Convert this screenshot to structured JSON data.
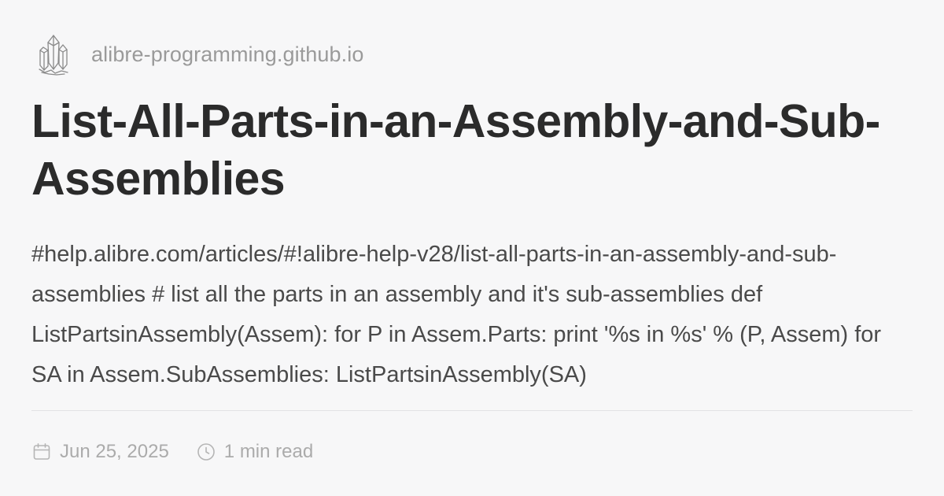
{
  "site": {
    "name": "alibre-programming.github.io",
    "logo_icon": "crystal-cluster-icon"
  },
  "post": {
    "title": "List-All-Parts-in-an-Assembly-and-Sub-Assemblies",
    "description": "#help.alibre.com/articles/#!alibre-help-v28/list-all-parts-in-an-assembly-and-sub-assemblies # list all the parts in an assembly and it's sub-assemblies def ListPartsinAssembly(Assem): for P in Assem.Parts: print '%s in %s' % (P, Assem) for SA in Assem.SubAssemblies: ListPartsinAssembly(SA)",
    "date": "Jun 25, 2025",
    "read_time": "1 min read"
  },
  "icons": {
    "date": "calendar-icon",
    "read_time": "clock-icon"
  },
  "colors": {
    "background": "#f7f7f8",
    "title": "#2b2b2b",
    "description": "#4a4a4a",
    "muted": "#9a9a9a",
    "divider": "#e3e3e5"
  }
}
